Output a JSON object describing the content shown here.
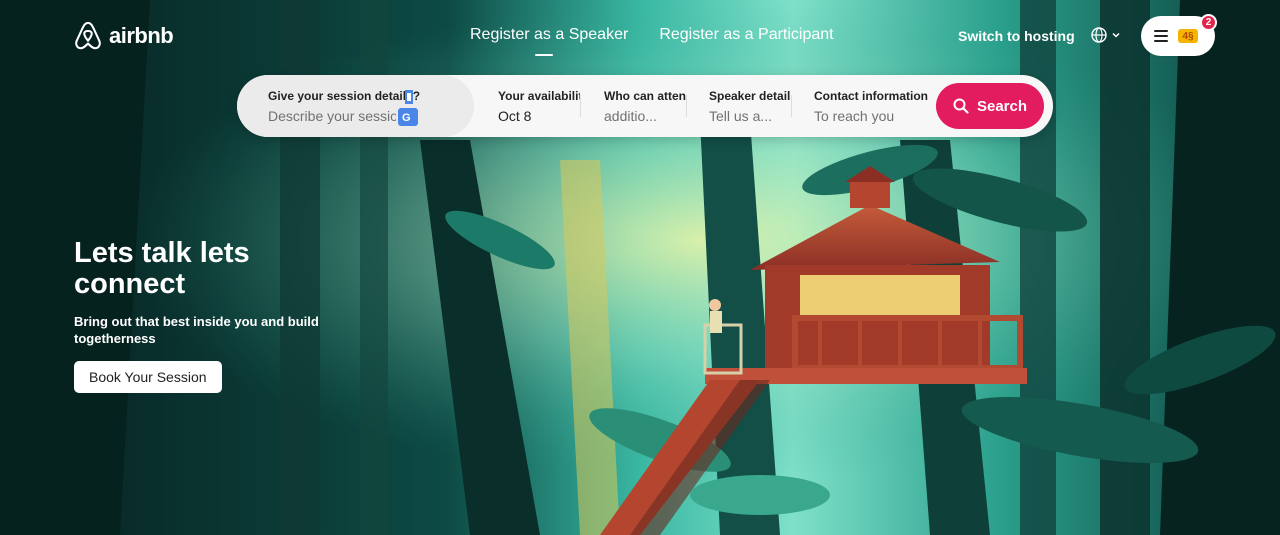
{
  "brand": {
    "name": "airbnb"
  },
  "nav": {
    "items": [
      {
        "label": "Register as a Speaker",
        "active": true
      },
      {
        "label": "Register as a Participant",
        "active": false
      }
    ]
  },
  "header": {
    "switch_label": "Switch to hosting",
    "notifications": "2",
    "avatar_badge": "4§"
  },
  "search": {
    "fields": [
      {
        "label": "Give your session details?",
        "value": "Describe your session"
      },
      {
        "label": "Your availability",
        "value": "Oct 8"
      },
      {
        "label": "Who can attend",
        "value": "additio..."
      },
      {
        "label": "Speaker details",
        "value": "Tell us a..."
      },
      {
        "label": "Contact information",
        "value": "To reach you"
      }
    ],
    "button_label": "Search"
  },
  "hero": {
    "title": "Lets talk lets connect",
    "subtitle": "Bring out that best inside you and build togetherness",
    "cta_label": "Book Your Session"
  },
  "colors": {
    "brand": "#e31c5f",
    "badge": "#e0264a"
  },
  "icons": [
    "airbnb-logo-icon",
    "globe-icon",
    "chevron-down-icon",
    "menu-icon",
    "search-icon",
    "translate-icon"
  ]
}
